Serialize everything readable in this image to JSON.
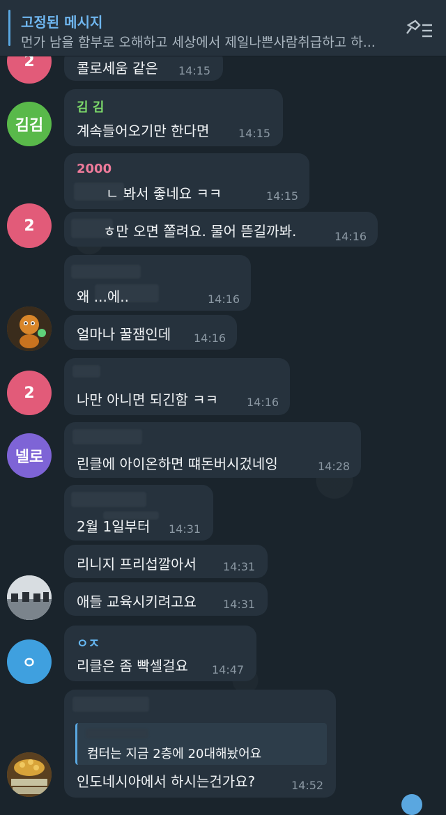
{
  "pinned": {
    "title": "고정된 메시지",
    "text": "먼가 남을 함부로 오해하고 세상에서 제일나쁜사람취급하고 하..."
  },
  "messages": [
    {
      "avatar": "2",
      "sender": "",
      "text": "콜로세움 같은",
      "time": "14:15"
    },
    {
      "avatar": "김김",
      "sender": "김 김",
      "text": "계속들어오기만 한다면",
      "time": "14:15"
    },
    {
      "avatar": "",
      "sender": "2000",
      "text": "ㄴ 봐서 좋네요 ㅋㅋ",
      "time": "14:15"
    },
    {
      "avatar": "2",
      "sender": "",
      "text": "ㅎ만 오면 쫄려요. 물어 뜯길까봐.",
      "time": "14:16"
    },
    {
      "avatar": "",
      "sender": "",
      "text": "왜 ...에..",
      "time": "14:16"
    },
    {
      "avatar": "",
      "sender": "",
      "text": "얼마나 꿀잼인데",
      "time": "14:16"
    },
    {
      "avatar": "2",
      "sender": "",
      "text": "나만 아니면 되긴함 ㅋㅋ",
      "time": "14:16"
    },
    {
      "avatar": "넬로",
      "sender": "",
      "text": "린클에 아이온하면 떄돈버시겄네잉",
      "time": "14:28"
    },
    {
      "avatar": "",
      "sender": "",
      "text": "2월 1일부터",
      "time": "14:31"
    },
    {
      "avatar": "",
      "sender": "",
      "text": "리니지 프리섭깔아서",
      "time": "14:31"
    },
    {
      "avatar": "",
      "sender": "",
      "text": "애들 교육시키려고요",
      "time": "14:31"
    },
    {
      "avatar": "ㅇ",
      "sender": "ㅇㅈ",
      "text": "리클은 좀 빡셀걸요",
      "time": "14:47"
    },
    {
      "avatar": "",
      "sender": "",
      "quote": "컴터는 지금 2층에 20대해놨어요",
      "text": "인도네시아에서 하시는건가요?",
      "time": "14:52"
    }
  ],
  "colors": {
    "avatar_pink": "#e25b79",
    "avatar_green": "#59b94a",
    "avatar_purple": "#7e64d6",
    "avatar_blue": "#3fa0df",
    "name_green": "#7ddc6b",
    "name_pink": "#ef7b9b",
    "name_blue": "#66b7f1"
  },
  "icons": {
    "pin": "unpin-list-icon"
  }
}
